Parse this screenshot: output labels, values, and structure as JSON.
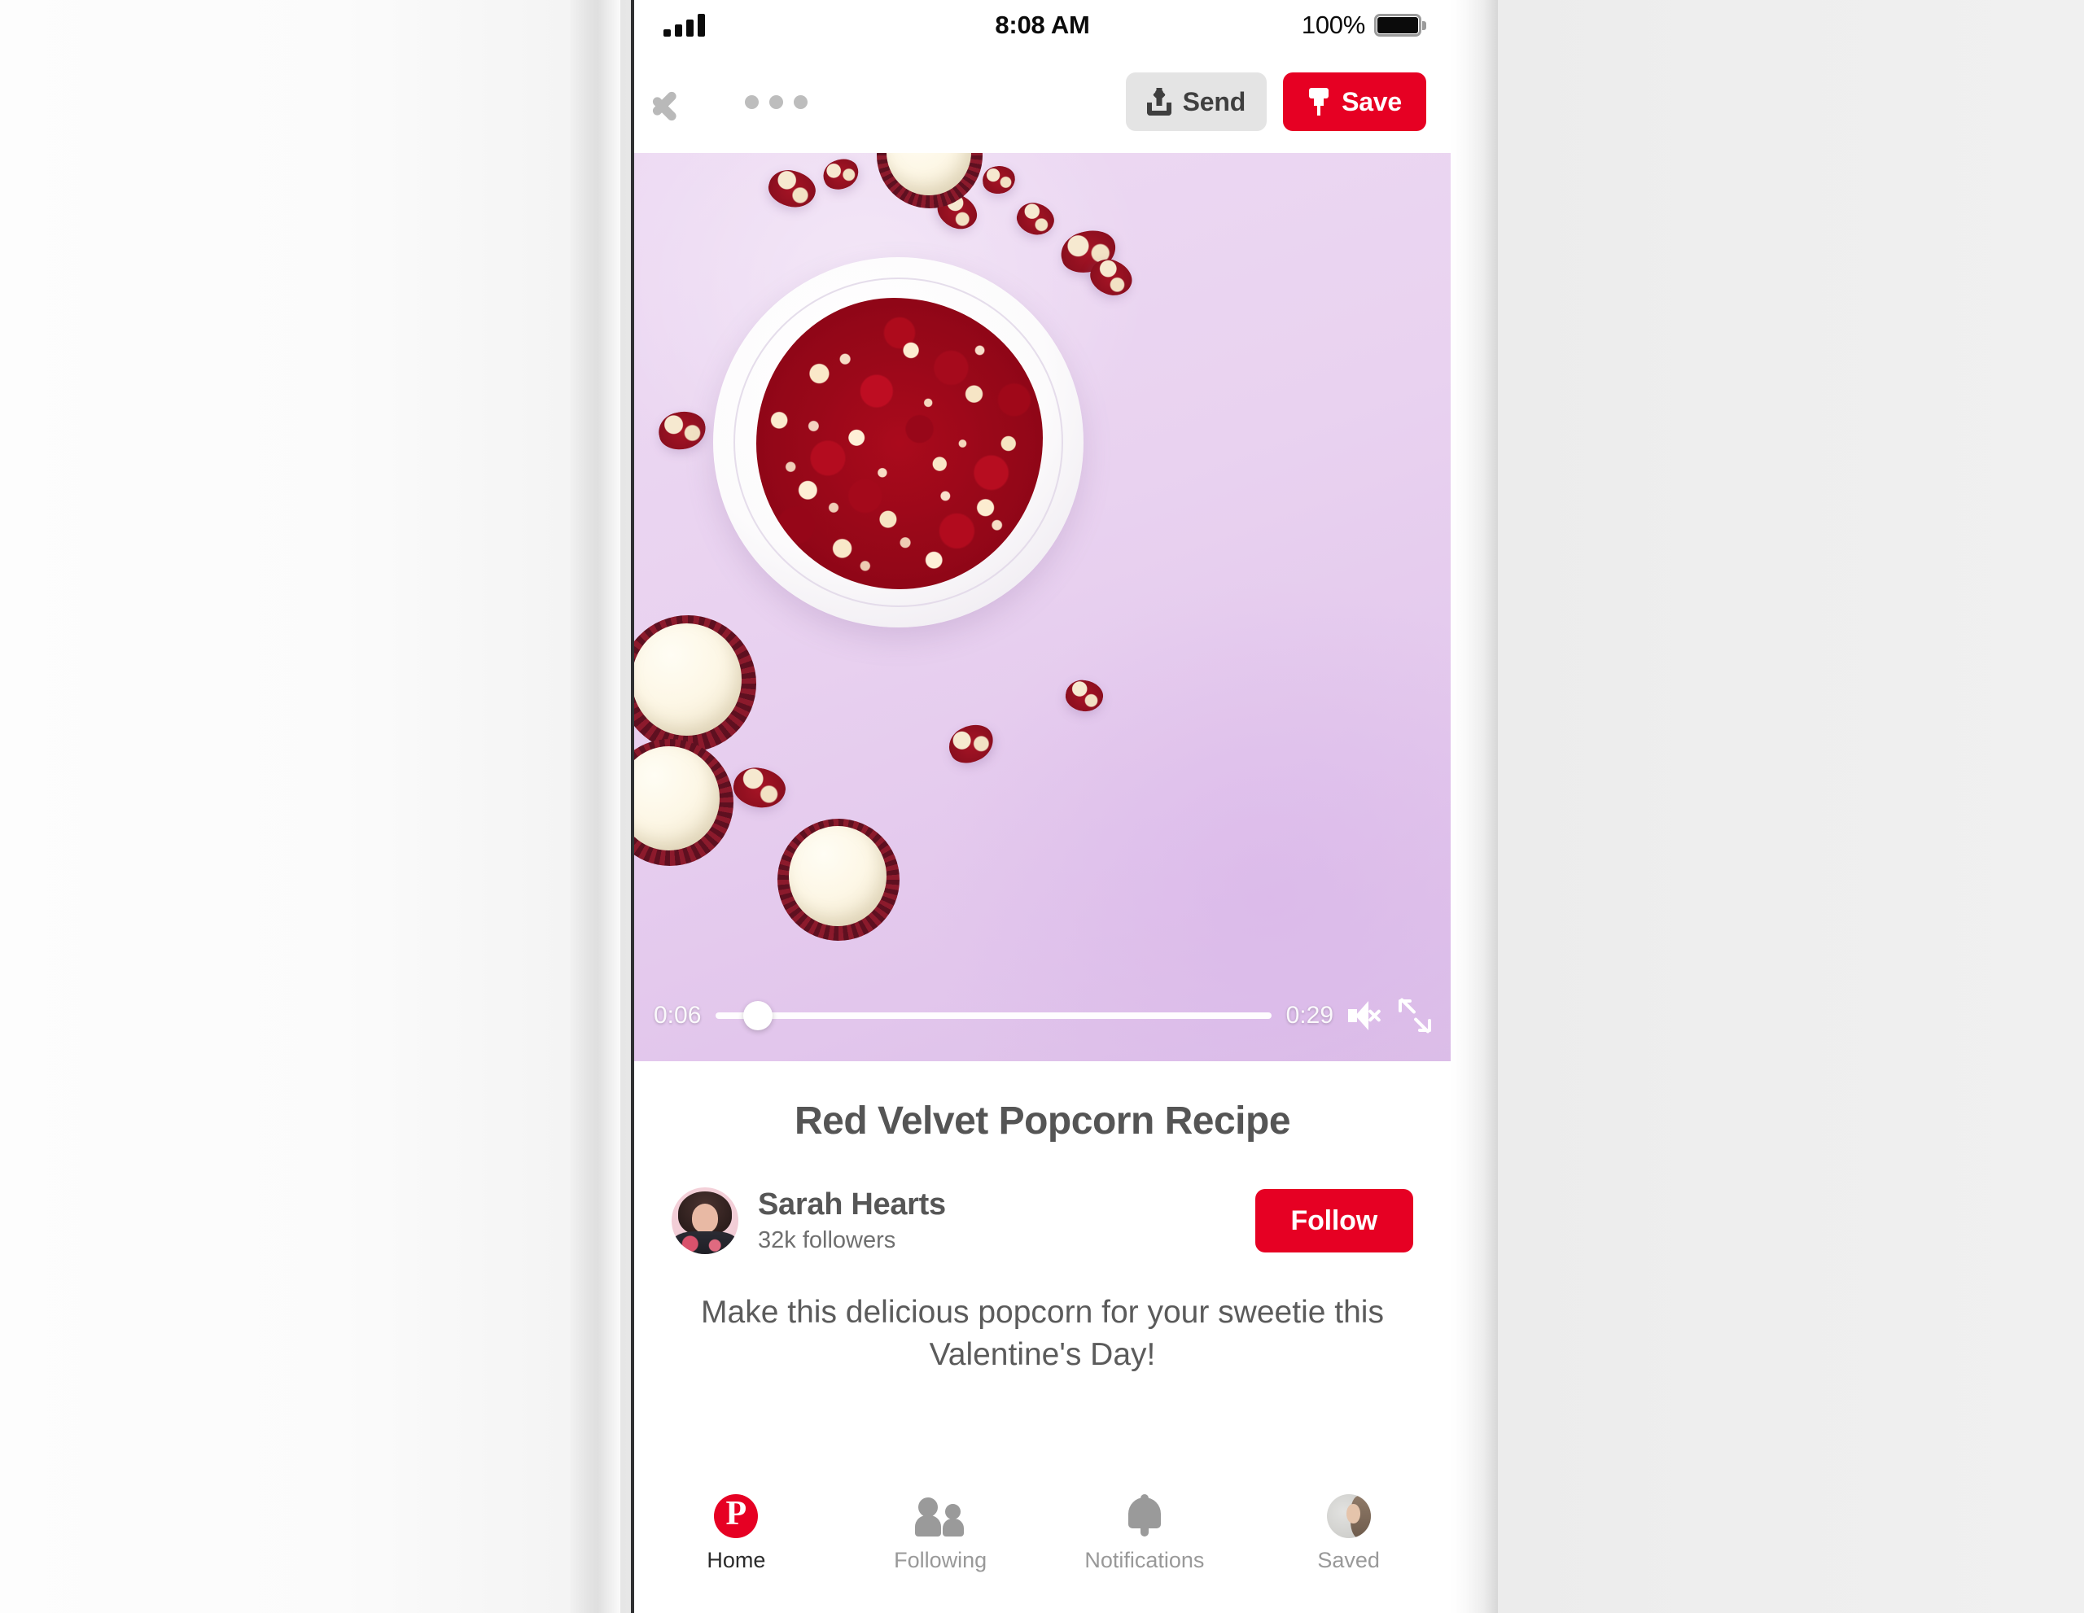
{
  "status_bar": {
    "signal_icon": "signal-bars-icon",
    "time": "8:08 AM",
    "battery_percent": "100%",
    "battery_icon": "battery-full-icon"
  },
  "nav_bar": {
    "back_icon": "back-chevron-icon",
    "more_icon": "more-options-icon",
    "send_label": "Send",
    "send_icon": "share-upload-icon",
    "save_label": "Save",
    "save_icon": "pushpin-icon",
    "save_bg_color": "#e60023",
    "send_bg_color": "#e4e4e4"
  },
  "video": {
    "current_time": "0:06",
    "duration": "0:29",
    "progress_percent": 7.5,
    "mute_icon": "speaker-mute-icon",
    "fullscreen_icon": "expand-fullscreen-icon",
    "background_color": "#e9d2f0",
    "subject": "red velvet popcorn on a white plate with cupcakes"
  },
  "details": {
    "title": "Red Velvet Popcorn Recipe",
    "author": {
      "avatar_icon": "author-avatar",
      "name": "Sarah Hearts",
      "followers": "32k followers"
    },
    "follow_label": "Follow",
    "follow_color": "#e60023",
    "description": "Make this delicious popcorn for your sweetie this Valentine's Day!"
  },
  "tab_bar": {
    "items": [
      {
        "label": "Home",
        "icon": "pinterest-logo-icon",
        "active": true,
        "glyph": "P"
      },
      {
        "label": "Following",
        "icon": "people-icon",
        "active": false
      },
      {
        "label": "Notifications",
        "icon": "bell-icon",
        "active": false
      },
      {
        "label": "Saved",
        "icon": "profile-avatar-icon",
        "active": false
      }
    ]
  }
}
